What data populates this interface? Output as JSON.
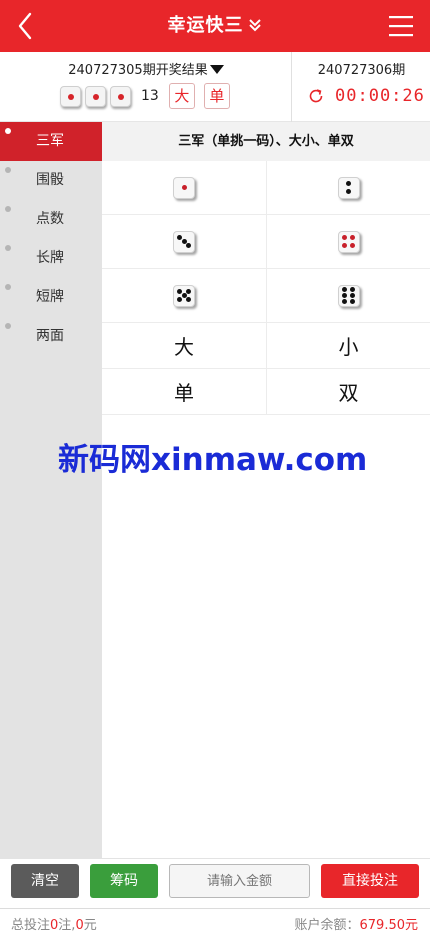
{
  "header": {
    "title": "幸运快三",
    "bg_color": "#e8262a"
  },
  "results": {
    "last_period_label": "240727305期开奖结果",
    "draw_sum": "13",
    "badge_size": "大",
    "badge_parity": "单",
    "next_period_label": "240727306期",
    "countdown": "00:00:26"
  },
  "sidebar": {
    "items": [
      {
        "label": "三军"
      },
      {
        "label": "围骰"
      },
      {
        "label": "点数"
      },
      {
        "label": "长牌"
      },
      {
        "label": "短牌"
      },
      {
        "label": "两面"
      }
    ],
    "active_index": 0
  },
  "main": {
    "section_title": "三军（单挑一码）、大小、单双",
    "dice_options": [
      1,
      2,
      3,
      4,
      5,
      6
    ],
    "text_options": [
      "大",
      "小",
      "单",
      "双"
    ]
  },
  "watermark": "新码网xinmaw.com",
  "bottom_bar": {
    "clear_label": "清空",
    "chips_label": "筹码",
    "amount_placeholder": "请输入金额",
    "bet_label": "直接投注"
  },
  "footer": {
    "total_prefix": "总投注",
    "total_bets": "0",
    "bets_unit": "注,",
    "total_amount": "0",
    "amount_unit": "元",
    "balance_label": "账户余额：",
    "balance_value": "679.50元"
  }
}
